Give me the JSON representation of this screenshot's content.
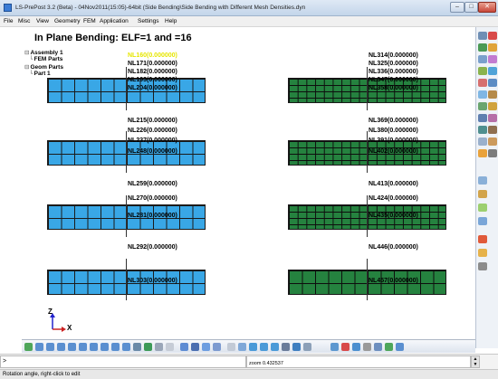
{
  "window": {
    "title": "LS-PrePost 3.2 (Beta) - 04Nov2011(15:05)-64bit (Side Bending\\Side Bending with Different Mesh Densities.dyn",
    "minimize_glyph": "–",
    "maximize_glyph": "□",
    "close_glyph": "✕"
  },
  "menu": {
    "items": [
      {
        "label": "File"
      },
      {
        "label": "Misc"
      },
      {
        "label": "View"
      },
      {
        "label": "Geometry"
      },
      {
        "label": "FEM"
      },
      {
        "label": "Application"
      },
      {
        "label": "Settings"
      },
      {
        "label": "Help"
      }
    ]
  },
  "viewport": {
    "title": "In Plane Bending: ELF=1 and =16",
    "tree": [
      {
        "glyph": "⊟",
        "label": "Assembly 1"
      },
      {
        "glyph": "└",
        "label": "FEM Parts"
      },
      {
        "glyph": "⊟",
        "label": "Geom Parts"
      },
      {
        "glyph": "└",
        "label": "Part 1"
      }
    ],
    "axis": {
      "z": "Z",
      "x": "X"
    },
    "left_labels": [
      {
        "text": "NL160(0.000000)",
        "highlight": true
      },
      {
        "text": "NL171(0.000000)"
      },
      {
        "text": "NL182(0.000000)"
      },
      {
        "text": "NL193(0.000000)"
      },
      {
        "text": "NL204(0.000000)"
      },
      {
        "text": "NL215(0.000000)"
      },
      {
        "text": "NL226(0.000000)"
      },
      {
        "text": "NL237(0.000000)"
      },
      {
        "text": "NL248(0.000000)"
      },
      {
        "text": "NL259(0.000000)"
      },
      {
        "text": "NL270(0.000000)"
      },
      {
        "text": "NL281(0.000000)"
      },
      {
        "text": "NL292(0.000000)"
      },
      {
        "text": "NL303(0.000000)"
      }
    ],
    "right_labels": [
      {
        "text": "NL314(0.000000)"
      },
      {
        "text": "NL325(0.000000)"
      },
      {
        "text": "NL336(0.000000)"
      },
      {
        "text": "NL347(0.000000)"
      },
      {
        "text": "NL358(0.000000)"
      },
      {
        "text": "NL369(0.000000)"
      },
      {
        "text": "NL380(0.000000)"
      },
      {
        "text": "NL391(0.000000)"
      },
      {
        "text": "NL402(0.000000)"
      },
      {
        "text": "NL413(0.000000)"
      },
      {
        "text": "NL424(0.000000)"
      },
      {
        "text": "NL435(0.000000)"
      },
      {
        "text": "NL446(0.000000)"
      },
      {
        "text": "NL457(0.000000)"
      }
    ],
    "colors": {
      "blue_mesh": "#39a7e6",
      "green_mesh": "#25823f",
      "highlight": "#e6e600"
    }
  },
  "command": {
    "prompt": ">",
    "zoom_readout": "zoom 0.432537"
  },
  "status": {
    "text": "Rotation angle, right-click to edit"
  }
}
